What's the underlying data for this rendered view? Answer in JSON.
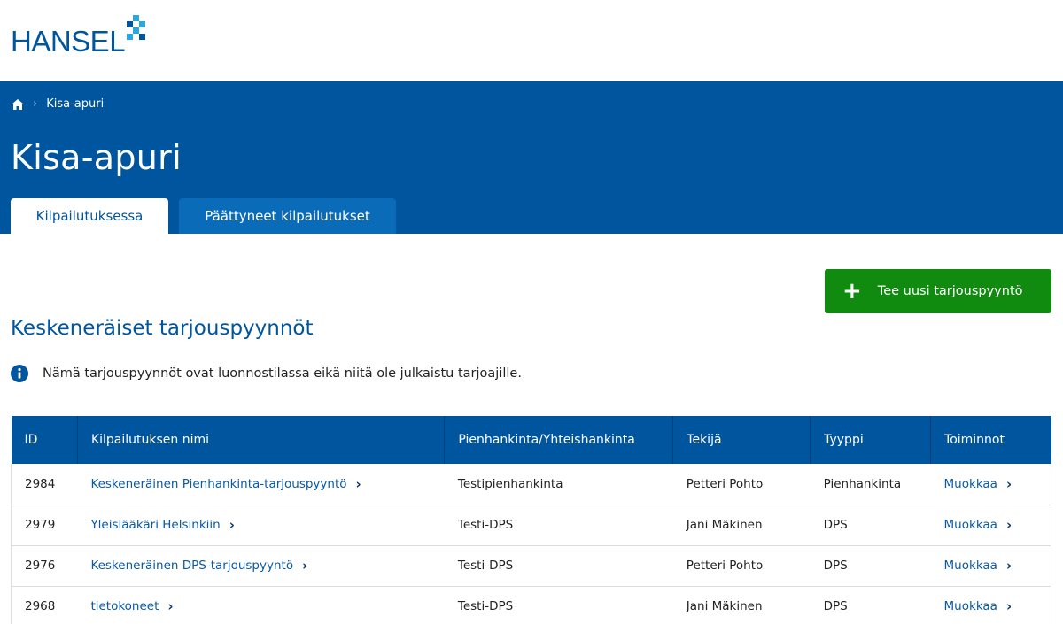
{
  "logo": {
    "text": "HANSEL",
    "mark": "hansel-cross-logo"
  },
  "breadcrumb": {
    "home_icon": "home-icon",
    "separator": "›",
    "current": "Kisa-apuri"
  },
  "page": {
    "title": "Kisa-apuri"
  },
  "tabs": [
    {
      "label": "Kilpailutuksessa",
      "active": true
    },
    {
      "label": "Päättyneet kilpailutukset",
      "active": false
    }
  ],
  "actions": {
    "new_request_label": "Tee uusi tarjouspyyntö",
    "icon": "plus-icon",
    "color": "#118a10"
  },
  "section": {
    "title": "Keskeneräiset tarjouspyynnöt",
    "info_icon": "info-icon",
    "info_text": "Nämä tarjouspyynnöt ovat luonnostilassa eikä niitä ole julkaistu tarjoajille."
  },
  "table": {
    "columns": [
      "ID",
      "Kilpailutuksen nimi",
      "Pienhankinta/Yhteishankinta",
      "Tekijä",
      "Tyyppi",
      "Toiminnot"
    ],
    "rows": [
      {
        "id": "2984",
        "name": "Keskeneräinen Pienhankinta-tarjouspyyntö",
        "procurement": "Testipienhankinta",
        "author": "Petteri Pohto",
        "type": "Pienhankinta",
        "action": "Muokkaa"
      },
      {
        "id": "2979",
        "name": "Yleislääkäri Helsinkiin",
        "procurement": "Testi-DPS",
        "author": "Jani Mäkinen",
        "type": "DPS",
        "action": "Muokkaa"
      },
      {
        "id": "2976",
        "name": "Keskeneräinen DPS-tarjouspyyntö",
        "procurement": "Testi-DPS",
        "author": "Petteri Pohto",
        "type": "DPS",
        "action": "Muokkaa"
      },
      {
        "id": "2968",
        "name": "tietokoneet",
        "procurement": "Testi-DPS",
        "author": "Jani Mäkinen",
        "type": "DPS",
        "action": "Muokkaa"
      }
    ]
  },
  "colors": {
    "brand": "#00559f",
    "tab_inactive": "#0a6bb8",
    "link": "#0a5aa5"
  }
}
